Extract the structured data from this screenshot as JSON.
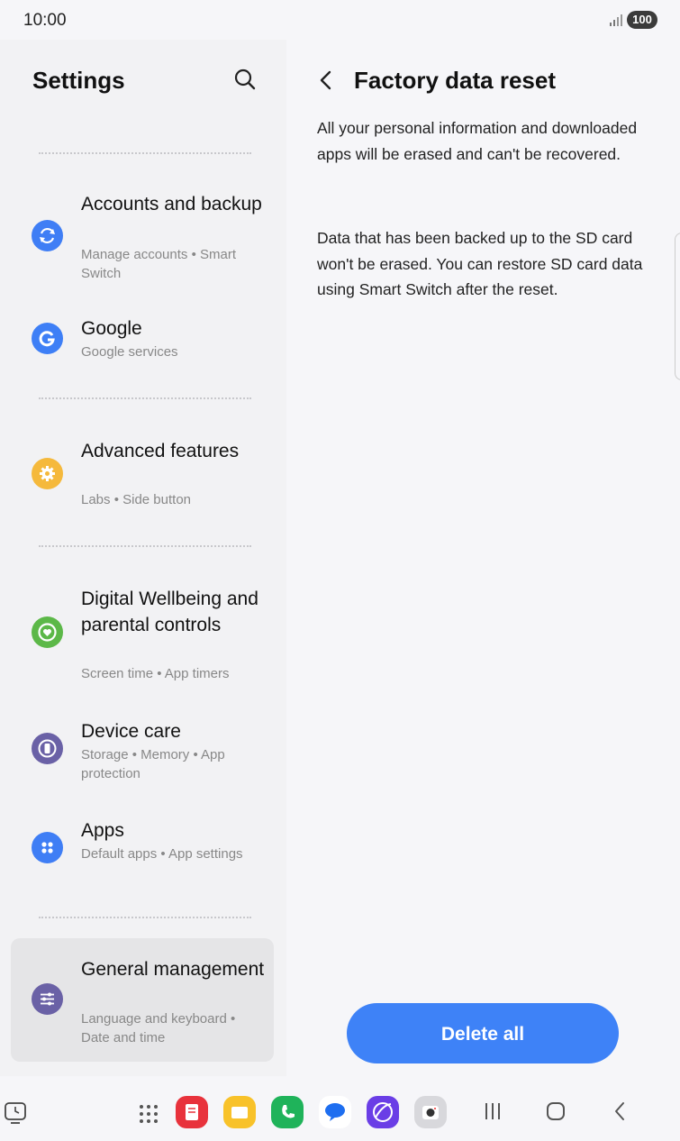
{
  "status": {
    "time": "10:00",
    "battery": "100"
  },
  "left": {
    "title": "Settings",
    "items": [
      {
        "title": "Accounts and backup",
        "subtitle": "Manage accounts • Smart Switch",
        "icon": "sync-icon",
        "color": "#3f7ef5"
      },
      {
        "title": "Google",
        "subtitle": "Google services",
        "icon": "google-g-icon",
        "color": "#3e7ff6"
      },
      {
        "title": "Advanced features",
        "subtitle": "Labs • Side button",
        "icon": "gear-plus-icon",
        "color": "#f5b93c"
      },
      {
        "title": "Digital Wellbeing and parental controls",
        "subtitle": "Screen time • App timers",
        "icon": "heart-circle-icon",
        "color": "#5cb848"
      },
      {
        "title": "Device care",
        "subtitle": "Storage • Memory • App protection",
        "icon": "device-care-icon",
        "color": "#6a61a6"
      },
      {
        "title": "Apps",
        "subtitle": "Default apps • App settings",
        "icon": "apps-grid-icon",
        "color": "#3f7ef5"
      },
      {
        "title": "General management",
        "subtitle": "Language and keyboard • Date and time",
        "icon": "sliders-icon",
        "color": "#6a61a6"
      }
    ]
  },
  "right": {
    "title": "Factory data reset",
    "paragraph1": "All your personal information and downloaded apps will be erased and can't be recovered.",
    "paragraph2": "Data that has been backed up to the SD card won't be erased. You can restore SD card data using Smart Switch after the reset.",
    "delete_label": "Delete all"
  },
  "dock": {
    "apps": [
      "app-drawer-icon",
      "notes-icon",
      "my-files-icon",
      "phone-icon",
      "messages-icon",
      "internet-icon",
      "camera-icon"
    ]
  },
  "colors": {
    "accent": "#3e82f7",
    "background": "#f6f6f9",
    "selected": "#e5e5e7"
  }
}
